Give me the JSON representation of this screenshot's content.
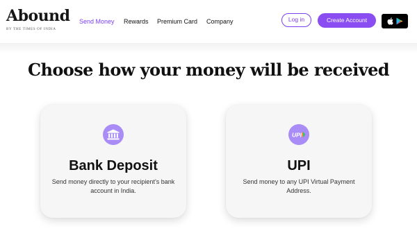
{
  "brand": {
    "name": "Abound",
    "tagline": "BY THE TIMES OF INDIA",
    "accent_color": "#7a3ff0",
    "button_color": "#8a4df2",
    "icon_bg_color": "#a98cf6"
  },
  "nav": {
    "items": [
      {
        "label": "Send Money",
        "active": true
      },
      {
        "label": "Rewards",
        "active": false
      },
      {
        "label": "Premium Card",
        "active": false
      },
      {
        "label": "Company",
        "active": false
      }
    ]
  },
  "header_actions": {
    "login_label": "Log in",
    "create_account_label": "Create Account",
    "store_icons": [
      "apple-icon",
      "google-play-icon"
    ]
  },
  "main": {
    "heading": "Choose how your money will be received",
    "options": [
      {
        "icon": "bank-icon",
        "title": "Bank Deposit",
        "description": "Send money directly to your recipient’s bank account in India."
      },
      {
        "icon": "upi-icon",
        "icon_text": "UPI",
        "title": "UPI",
        "description": "Send money to any UPI Virtual Payment Address."
      }
    ]
  }
}
